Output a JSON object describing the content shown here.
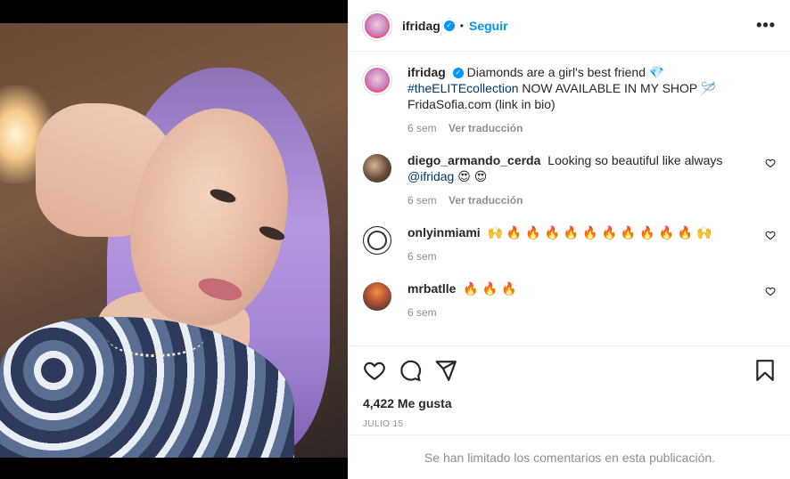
{
  "post": {
    "username": "ifridag",
    "follow_label": "Seguir",
    "more_label": "•••"
  },
  "comments": [
    {
      "user": "ifridag",
      "text_before": "Diamonds are a girl's best friend 💎",
      "hashtag": "#theELITEcollection",
      "text_after": "NOW AVAILABLE IN MY SHOP 🪡 FridaSofia.com (link in bio)",
      "time": "6 sem",
      "translate": "Ver traducción"
    },
    {
      "user": "diego_armando_cerda",
      "text": "Looking so beautiful like always",
      "mention": "@ifridag",
      "emoji": "😍 😍",
      "time": "6 sem",
      "translate": "Ver traducción"
    },
    {
      "user": "onlyinmiami",
      "text": "🙌 🔥 🔥 🔥 🔥 🔥 🔥 🔥 🔥 🔥 🔥 🙌",
      "time": "6 sem"
    },
    {
      "user": "mrbatlle",
      "text": "🔥 🔥 🔥",
      "time": "6 sem"
    }
  ],
  "footer": {
    "likes": "4,422 Me gusta",
    "date": "JULIO 15",
    "limited_comments": "Se han limitado los comentarios en esta publicación."
  },
  "colors": {
    "accent": "#0095f6",
    "link": "#00376b",
    "muted": "#8e8e8e"
  },
  "icons": [
    "verified-badge-icon",
    "more-options-icon",
    "heart-icon",
    "comment-icon",
    "share-icon",
    "bookmark-icon"
  ]
}
